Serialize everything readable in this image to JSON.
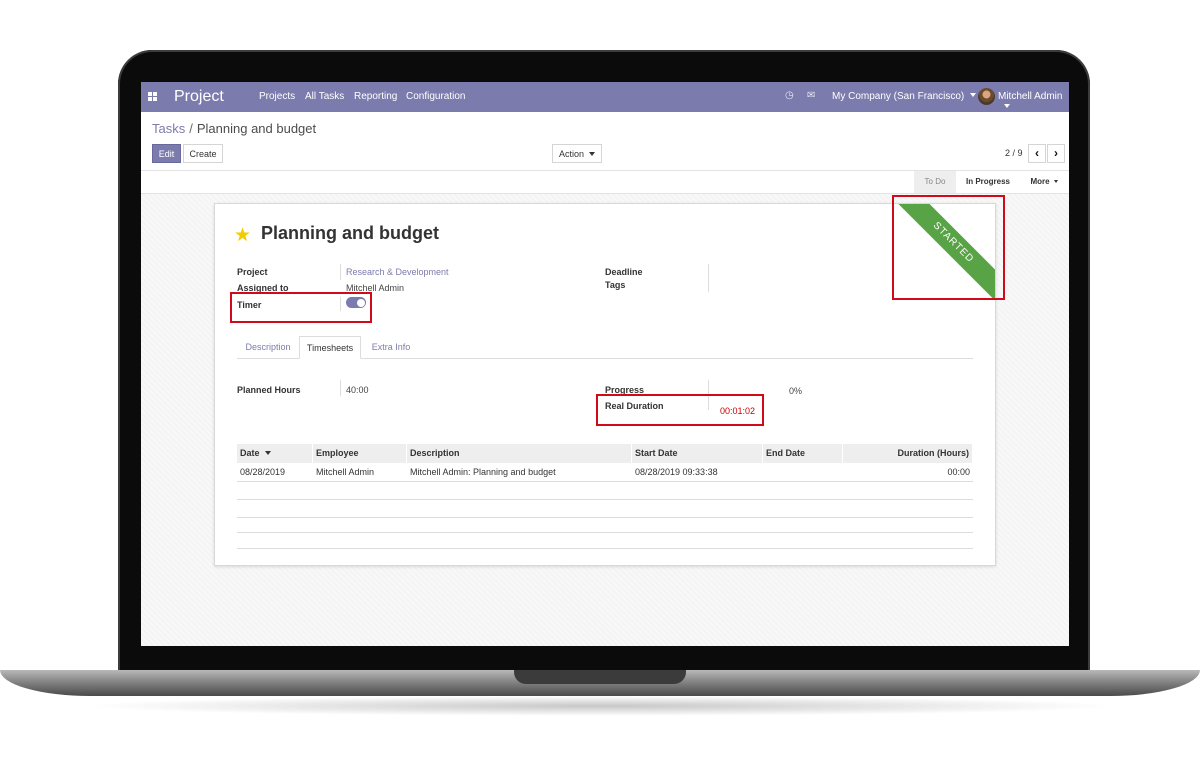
{
  "navbar": {
    "app_name": "Project",
    "menu": [
      "Projects",
      "All Tasks",
      "Reporting",
      "Configuration"
    ],
    "company": "My Company (San Francisco)",
    "user": "Mitchell Admin",
    "icons": [
      "apps-grid-icon",
      "clock-icon",
      "chat-icon"
    ]
  },
  "breadcrumb": {
    "parent": "Tasks",
    "separator": "/",
    "current": "Planning and budget"
  },
  "buttons": {
    "edit": "Edit",
    "create": "Create",
    "action": "Action"
  },
  "pager": {
    "value": "2 / 9",
    "prev": "‹",
    "next": "›"
  },
  "stages": {
    "todo": "To Do",
    "in_progress": "In Progress",
    "more": "More"
  },
  "task": {
    "title": "Planning and budget",
    "ribbon": "STARTED",
    "project_label": "Project",
    "project_value": "Research & Development",
    "assigned_label": "Assigned to",
    "assigned_value": "Mitchell Admin",
    "timer_label": "Timer",
    "timer_on": true,
    "deadline_label": "Deadline",
    "tags_label": "Tags"
  },
  "tabs": [
    "Description",
    "Timesheets",
    "Extra Info"
  ],
  "timesheets": {
    "planned_label": "Planned Hours",
    "planned_value": "40:00",
    "progress_label": "Progress",
    "progress_value": "0%",
    "duration_label": "Real Duration",
    "duration_value": "00:01:02",
    "columns": [
      "Date",
      "Employee",
      "Description",
      "Start Date",
      "End Date",
      "Duration (Hours)"
    ],
    "rows": [
      {
        "date": "08/28/2019",
        "employee": "Mitchell Admin",
        "description": "Mitchell Admin: Planning and budget",
        "start_date": "08/28/2019 09:33:38",
        "end_date": "",
        "duration": "00:00"
      }
    ]
  },
  "colors": {
    "brand": "#7c7bad",
    "ribbon": "#58a345",
    "highlight": "#d10a1a",
    "duration_text": "#cc0000",
    "star": "#f3cc00"
  }
}
